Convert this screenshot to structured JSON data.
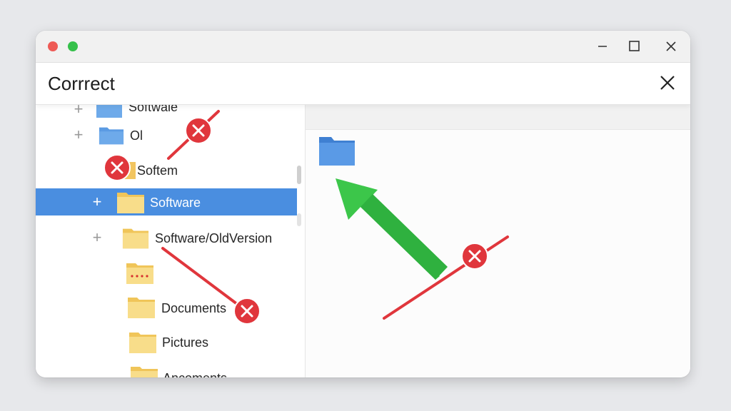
{
  "window": {
    "controls": {
      "close_dot_color": "#ee5a55",
      "zoom_dot_color": "#35c04a",
      "minimize_icon": "minimize-icon",
      "maximize_icon": "maximize-icon",
      "close_icon": "close-icon"
    }
  },
  "dialog": {
    "title": "Corrrect",
    "close_icon": "close-icon"
  },
  "tree": {
    "items": [
      {
        "label": "Softwale",
        "expander": "+",
        "icon": "folder-blue-icon"
      },
      {
        "label": "Ol",
        "expander": "+",
        "icon": "folder-blue-icon"
      },
      {
        "label": "Softem",
        "icon": "folder-yellow-icon"
      },
      {
        "label": "Software",
        "expander": "+",
        "icon": "folder-yellow-icon",
        "selected": true
      },
      {
        "label": "Software/OldVersion",
        "expander": "+",
        "icon": "folder-yellow-icon"
      },
      {
        "label": "",
        "icon": "folder-dotted-icon"
      },
      {
        "label": "Documents",
        "icon": "folder-yellow-icon"
      },
      {
        "label": "Pictures",
        "icon": "folder-yellow-icon"
      },
      {
        "label": "Ancoments",
        "icon": "folder-yellow-icon"
      }
    ]
  },
  "right_pane": {
    "icon": "folder-blue-icon"
  },
  "annotations": {
    "wrong_mark_icon": "x-mark-icon",
    "correct_arrow_icon": "green-arrow-icon",
    "wrong_color": "#e0363c",
    "correct_color": "#3cc64a"
  },
  "colors": {
    "selection": "#4a8ee0",
    "folder_yellow": "#f7d77c",
    "folder_blue": "#4a90dc"
  }
}
